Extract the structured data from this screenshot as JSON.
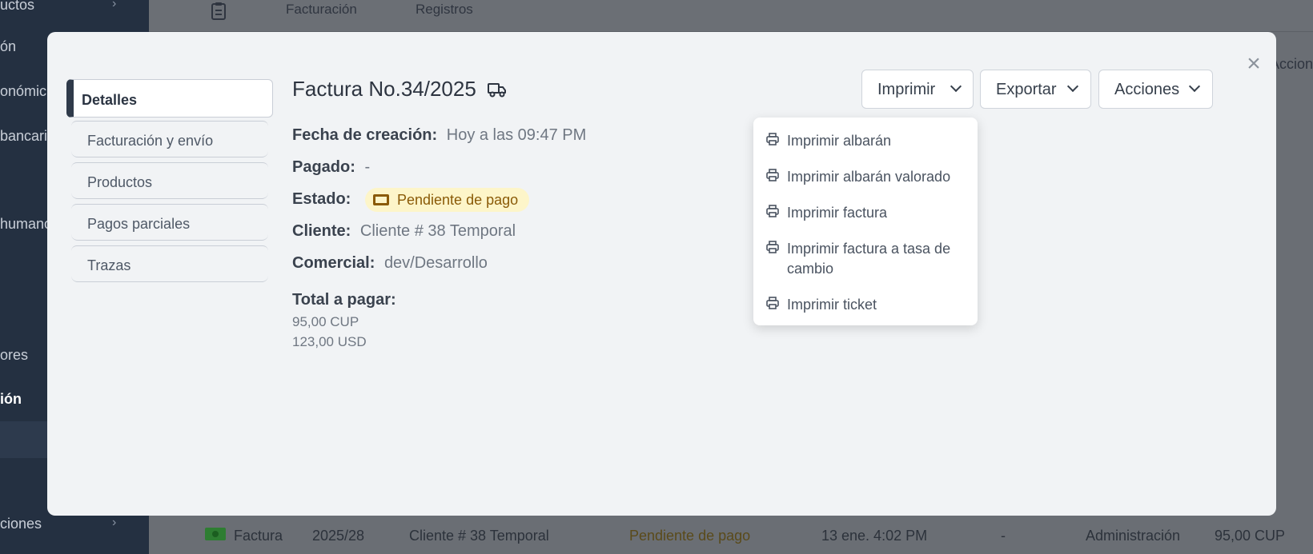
{
  "background": {
    "sidebar": {
      "items": [
        {
          "label": "uctos"
        },
        {
          "label": "ón"
        },
        {
          "label": "onómic"
        },
        {
          "label": "bancari"
        },
        {
          "label": "humano"
        },
        {
          "label": "ores"
        },
        {
          "label": "ión"
        },
        {
          "label": "ciones"
        }
      ]
    },
    "breadcrumbs": [
      "Facturación",
      "Registros"
    ],
    "right_header": "Accion",
    "row": {
      "type": "Factura",
      "number": "2025/28",
      "client": "Cliente # 38 Temporal",
      "status": "Pendiente de pago",
      "date": "13 ene. 4:02 PM",
      "paid": "-",
      "agent": "Administración",
      "amount": "95,00 CUP"
    }
  },
  "modal": {
    "tabs": [
      {
        "label": "Detalles"
      },
      {
        "label": "Facturación y envío"
      },
      {
        "label": "Productos"
      },
      {
        "label": "Pagos parciales"
      },
      {
        "label": "Trazas"
      }
    ],
    "title": "Factura No.34/2025",
    "fields": {
      "created_label": "Fecha de creación:",
      "created_value": "Hoy a las 09:47 PM",
      "paid_label": "Pagado:",
      "paid_value": "-",
      "status_label": "Estado:",
      "status_value": "Pendiente de pago",
      "client_label": "Cliente:",
      "client_value": "Cliente # 38 Temporal",
      "agent_label": "Comercial:",
      "agent_value": "dev/Desarrollo",
      "total_label": "Total a pagar:",
      "amounts": [
        "95,00 CUP",
        "123,00 USD"
      ]
    },
    "buttons": {
      "print": "Imprimir",
      "export": "Exportar",
      "actions": "Acciones"
    },
    "print_menu": [
      "Imprimir albarán",
      "Imprimir albarán valorado",
      "Imprimir factura",
      "Imprimir factura a tasa de cambio",
      "Imprimir ticket"
    ],
    "colors": {
      "badge_bg": "#fdf5c9",
      "badge_text": "#8a5a07",
      "active_tab_bar": "#2f3a4a"
    }
  }
}
